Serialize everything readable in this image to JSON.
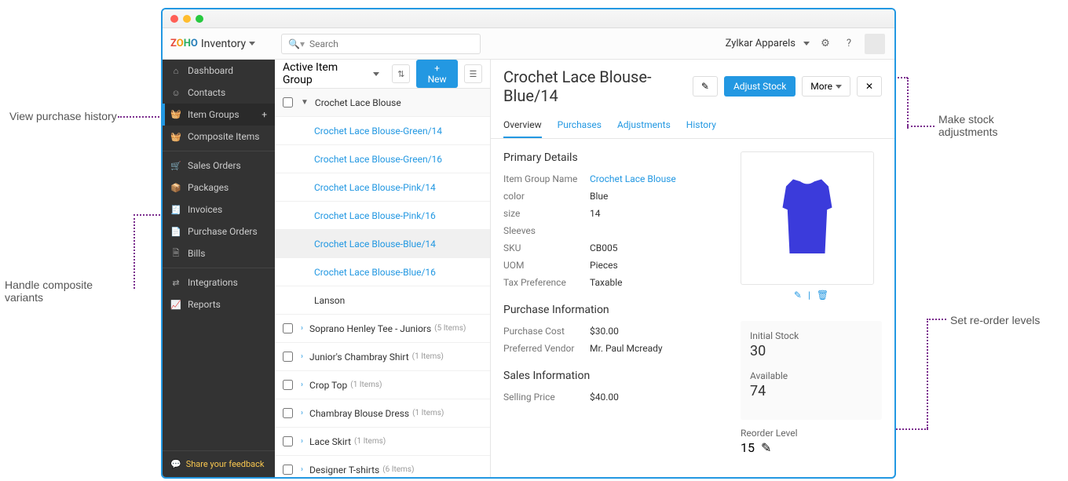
{
  "brand": {
    "inventory_label": "Inventory"
  },
  "search_placeholder": "Search",
  "user": {
    "company": "Zylkar Apparels"
  },
  "sidebar": {
    "items": [
      {
        "label": "Dashboard"
      },
      {
        "label": "Contacts"
      },
      {
        "label": "Item Groups"
      },
      {
        "label": "Composite Items"
      },
      {
        "label": "Sales Orders"
      },
      {
        "label": "Packages"
      },
      {
        "label": "Invoices"
      },
      {
        "label": "Purchase Orders"
      },
      {
        "label": "Bills"
      },
      {
        "label": "Integrations"
      },
      {
        "label": "Reports"
      }
    ],
    "feedback": "Share your feedback"
  },
  "list": {
    "heading": "Active Item Group",
    "new_btn": "+ New",
    "groups": [
      {
        "name": "Crochet Lace Blouse",
        "expanded": true,
        "variants": [
          "Crochet Lace Blouse-Green/14",
          "Crochet Lace Blouse-Green/16",
          "Crochet Lace Blouse-Pink/14",
          "Crochet Lace Blouse-Pink/16",
          "Crochet Lace Blouse-Blue/14",
          "Crochet Lace Blouse-Blue/16",
          "Lanson"
        ]
      },
      {
        "name": "Soprano Henley Tee - Juniors",
        "count": "(5 Items)"
      },
      {
        "name": "Junior's Chambray Shirt",
        "count": "(1 Items)"
      },
      {
        "name": "Crop Top",
        "count": "(1 Items)"
      },
      {
        "name": "Chambray Blouse Dress",
        "count": "(1 Items)"
      },
      {
        "name": "Lace Skirt",
        "count": "(1 Items)"
      },
      {
        "name": "Designer T-shirts",
        "count": "(6 Items)"
      }
    ]
  },
  "detail": {
    "title": "Crochet Lace Blouse-Blue/14",
    "adjust_btn": "Adjust Stock",
    "more_btn": "More",
    "tabs": [
      "Overview",
      "Purchases",
      "Adjustments",
      "History"
    ],
    "primary_heading": "Primary Details",
    "primary": [
      {
        "k": "Item Group Name",
        "v": "Crochet Lace Blouse",
        "link": true
      },
      {
        "k": "color",
        "v": "Blue"
      },
      {
        "k": "size",
        "v": "14"
      },
      {
        "k": "Sleeves",
        "v": ""
      },
      {
        "k": "SKU",
        "v": "CB005"
      },
      {
        "k": "UOM",
        "v": "Pieces"
      },
      {
        "k": "Tax Preference",
        "v": "Taxable"
      }
    ],
    "purchase_heading": "Purchase Information",
    "purchase": [
      {
        "k": "Purchase Cost",
        "v": "$30.00"
      },
      {
        "k": "Preferred Vendor",
        "v": "Mr. Paul Mcready"
      }
    ],
    "sales_heading": "Sales Information",
    "sales": [
      {
        "k": "Selling Price",
        "v": "$40.00"
      }
    ],
    "stock": {
      "initial_lbl": "Initial Stock",
      "initial": "30",
      "avail_lbl": "Available",
      "avail": "74",
      "reorder_lbl": "Reorder Level",
      "reorder": "15"
    }
  },
  "annotations": {
    "purchase_history": "View purchase history",
    "composite": "Handle composite variants",
    "stock_adj": "Make stock adjustments",
    "reorder": "Set re-order levels"
  }
}
